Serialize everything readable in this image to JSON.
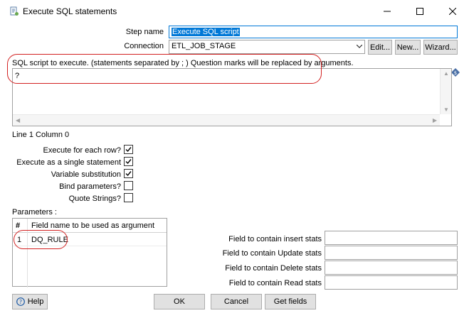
{
  "window": {
    "title": "Execute SQL statements",
    "minimize_icon": "minimize-icon",
    "maximize_icon": "maximize-icon",
    "close_icon": "close-icon"
  },
  "form": {
    "step_name_label": "Step name",
    "step_name_value": "Execute SQL script",
    "connection_label": "Connection",
    "connection_value": "ETL_JOB_STAGE",
    "edit_label": "Edit...",
    "new_label": "New...",
    "wizard_label": "Wizard..."
  },
  "sql": {
    "description": "SQL script to execute. (statements separated by ; ) Question marks will be replaced by arguments.",
    "script": "?",
    "position": "Line 1 Column 0"
  },
  "options": [
    {
      "label": "Execute for each row?",
      "checked": true
    },
    {
      "label": "Execute as a single statement",
      "checked": true
    },
    {
      "label": "Variable substitution",
      "checked": true
    },
    {
      "label": "Bind parameters?",
      "checked": false
    },
    {
      "label": "Quote Strings?",
      "checked": false
    }
  ],
  "parameters": {
    "label": "Parameters :",
    "columns": [
      "#",
      "Field name to be used as argument"
    ],
    "rows": [
      {
        "num": "1",
        "field": "DQ_RULE"
      }
    ]
  },
  "stats": {
    "insert_label": "Field to contain insert stats",
    "update_label": "Field to contain Update stats",
    "delete_label": "Field to contain Delete stats",
    "read_label": "Field to contain Read stats",
    "insert_value": "",
    "update_value": "",
    "delete_value": "",
    "read_value": ""
  },
  "buttons": {
    "help": "Help",
    "ok": "OK",
    "cancel": "Cancel",
    "get_fields": "Get fields"
  },
  "colors": {
    "accent": "#0078d7",
    "annotation": "#d32121"
  }
}
